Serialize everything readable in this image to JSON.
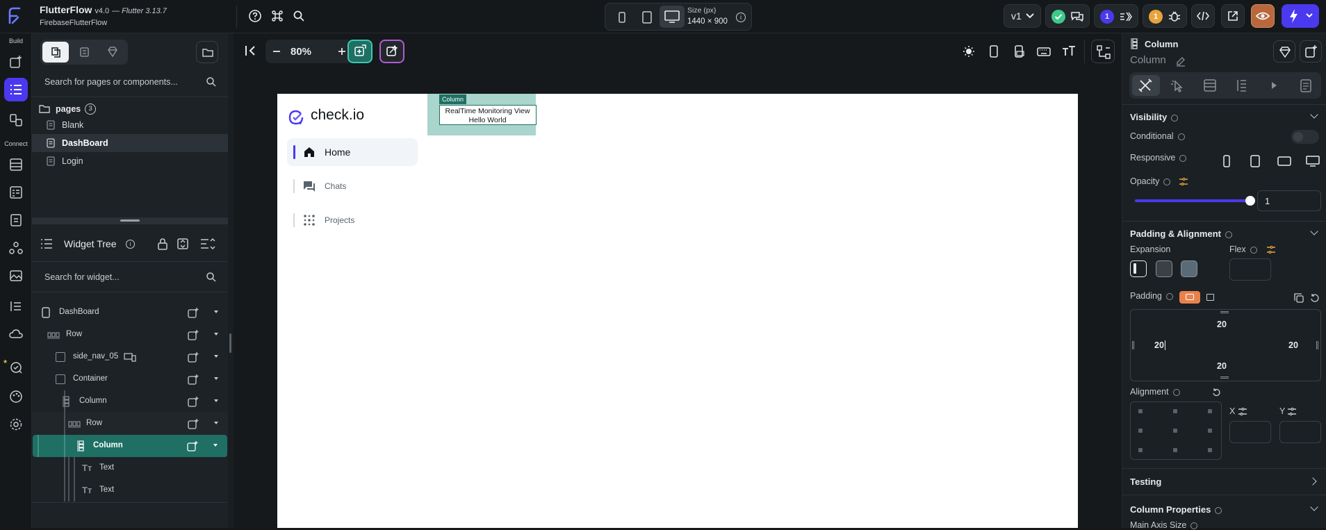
{
  "app": {
    "name": "FlutterFlow",
    "version": "v4.0",
    "flutter": "— Flutter 3.13.7",
    "project": "FirebaseFlutterFlow"
  },
  "topbar": {
    "size_label": "Size (px)",
    "size_value": "1440 × 900",
    "branch": "v1",
    "badge_users": "1",
    "badge_warnings": "1"
  },
  "rail": {
    "build_label": "Build",
    "connect_label": "Connect"
  },
  "pages_panel": {
    "search_placeholder": "Search for pages or components...",
    "pages_label": "pages",
    "pages_count": "3",
    "pages": [
      {
        "name": "Blank",
        "selected": false
      },
      {
        "name": "DashBoard",
        "selected": true
      },
      {
        "name": "Login",
        "selected": false
      }
    ]
  },
  "widget_tree": {
    "title": "Widget Tree",
    "search_placeholder": "Search for widget...",
    "nodes": [
      {
        "label": "DashBoard",
        "icon": "phone-icon",
        "depth": 0
      },
      {
        "label": "Row",
        "icon": "row-icon",
        "depth": 1
      },
      {
        "label": "side_nav_05",
        "icon": "component-icon",
        "depth": 2
      },
      {
        "label": "Container",
        "icon": "container-icon",
        "depth": 2
      },
      {
        "label": "Column",
        "icon": "column-icon",
        "depth": 3
      },
      {
        "label": "Row",
        "icon": "row-icon",
        "depth": 4
      },
      {
        "label": "Column",
        "icon": "column-icon",
        "depth": 5,
        "selected": true
      },
      {
        "label": "Text",
        "icon": "text-icon",
        "depth": 6
      },
      {
        "label": "Text",
        "icon": "text-icon",
        "depth": 6
      }
    ]
  },
  "canvas": {
    "zoom": "80%",
    "app_logo": "check.io",
    "nav": [
      {
        "label": "Home",
        "active": true,
        "icon": "home-icon"
      },
      {
        "label": "Chats",
        "active": false,
        "icon": "chat-icon"
      },
      {
        "label": "Projects",
        "active": false,
        "icon": "grid-dots-icon"
      }
    ],
    "selection_tag": "Column",
    "text1": "RealTime Monitoring View",
    "text2": "Hello World"
  },
  "props": {
    "widget_type": "Column",
    "widget_name": "Column",
    "visibility_title": "Visibility",
    "conditional_label": "Conditional",
    "responsive_label": "Responsive",
    "opacity_label": "Opacity",
    "opacity_value": "1",
    "opacity_fraction": 1.0,
    "padding_align_title": "Padding & Alignment",
    "expansion_label": "Expansion",
    "flex_label": "Flex",
    "padding_label": "Padding",
    "pad_top": "20",
    "pad_left": "20",
    "pad_right": "20",
    "pad_bottom": "20",
    "alignment_label": "Alignment",
    "x_label": "X",
    "y_label": "Y",
    "testing_title": "Testing",
    "column_props_title": "Column Properties",
    "main_axis_label": "Main Axis Size"
  },
  "colors": {
    "accent_teal": "#1f6f64",
    "accent_purple": "#4b39ef",
    "accent_orange": "#e8a33d",
    "check_green": "#3ec98a",
    "badge_blue": "#4b39ef"
  }
}
